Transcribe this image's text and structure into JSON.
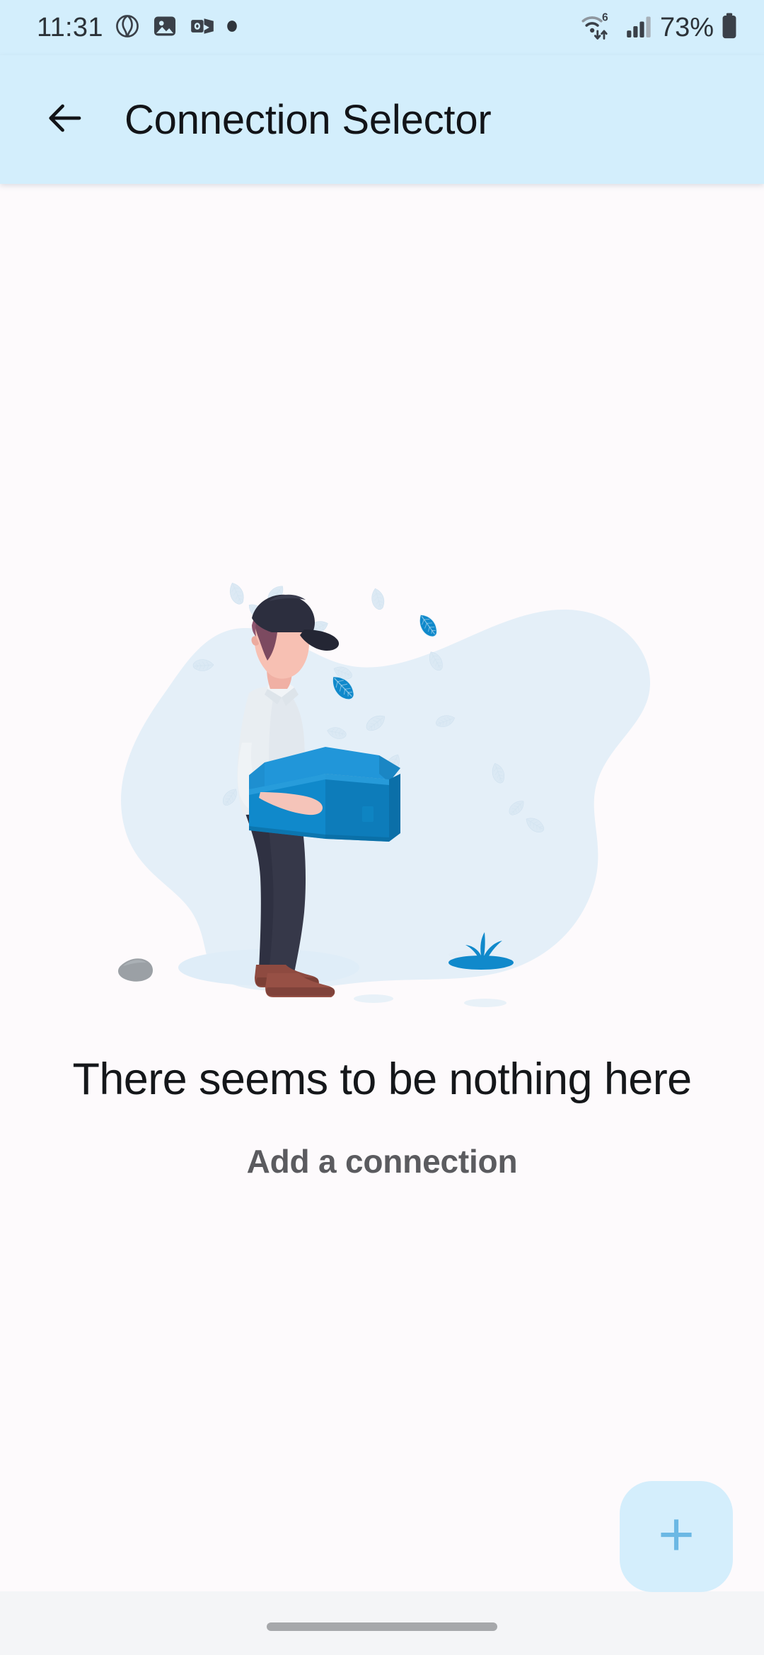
{
  "status_bar": {
    "time": "11:31",
    "battery_percent": "73%",
    "icons": [
      {
        "name": "browser-globe-icon"
      },
      {
        "name": "photo-gallery-icon"
      },
      {
        "name": "outlook-mail-icon"
      },
      {
        "name": "notification-dot-icon"
      }
    ],
    "right_icons": [
      {
        "name": "wifi-6-icon",
        "label": "6"
      },
      {
        "name": "cellular-signal-icon"
      },
      {
        "name": "battery-icon"
      }
    ],
    "background_color": "#d3eefc",
    "text_color": "#2c3238"
  },
  "app_bar": {
    "title": "Connection Selector",
    "back_icon": "arrow-left-icon",
    "background_color": "#d3eefc",
    "title_color": "#121418"
  },
  "empty_state": {
    "illustration_name": "person-holding-empty-box-illustration",
    "title": "There seems to be nothing here",
    "subtitle": "Add a connection",
    "title_color": "#15171a",
    "subtitle_color": "#5b5b5f",
    "blob_color": "#e4eff8",
    "accent_blue": "#1089cb",
    "light_blue": "#2196d9"
  },
  "fab": {
    "icon": "plus-icon",
    "label": "+",
    "background_color": "#d4eefc",
    "icon_color": "#6bb8e4"
  },
  "nav_bar": {
    "gesture_pill": "home-gesture-pill",
    "background_color": "#f4f5f7",
    "pill_color": "#a6a8ab"
  },
  "page_background": "#fdfafc"
}
